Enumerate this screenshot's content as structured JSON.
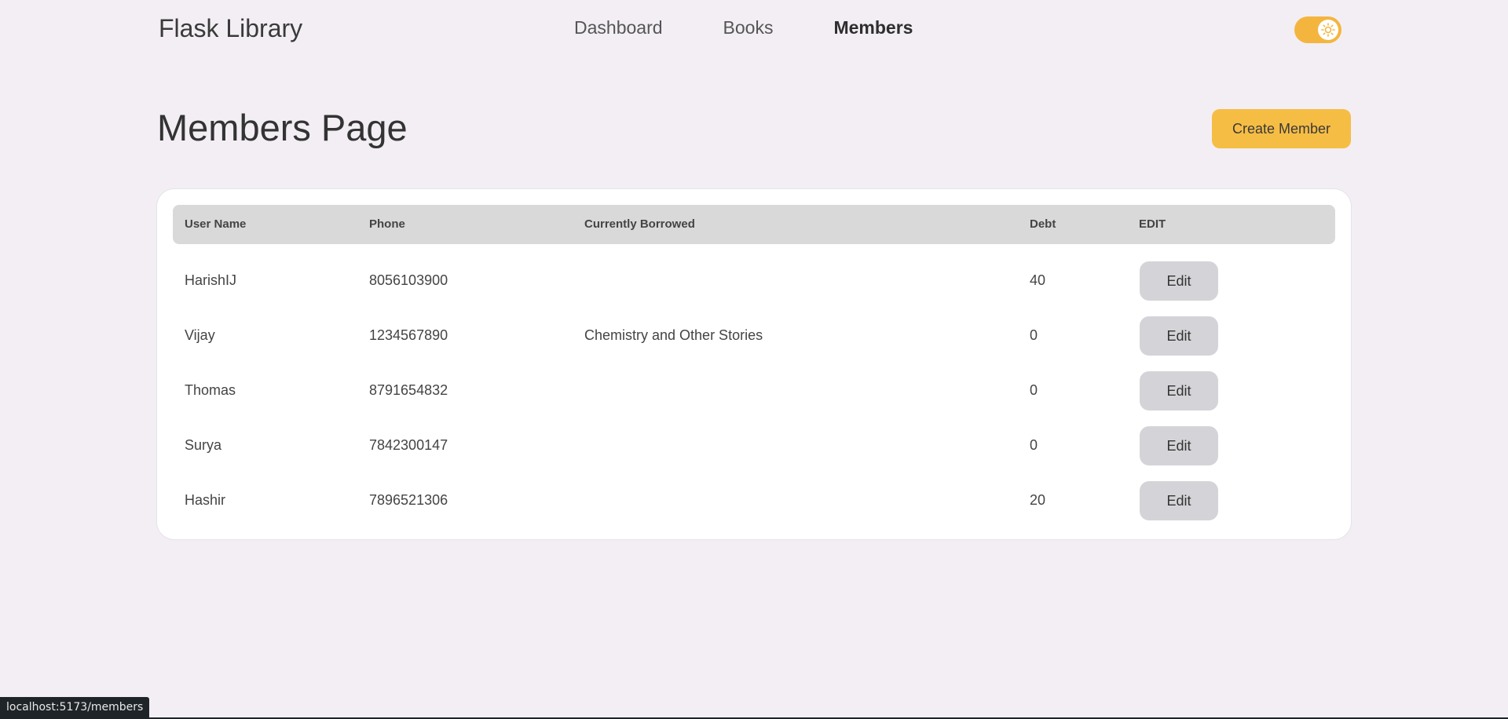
{
  "header": {
    "brand": "Flask Library",
    "nav": [
      "Dashboard",
      "Books",
      "Members"
    ],
    "active_nav": "Members",
    "toggle_icon": "sun-icon",
    "accent_color": "#f4b53f"
  },
  "main": {
    "title": "Members Page",
    "create_label": "Create Member"
  },
  "table": {
    "columns": [
      "User Name",
      "Phone",
      "Currently Borrowed",
      "Debt",
      "EDIT"
    ],
    "rows": [
      {
        "name": "HarishIJ",
        "phone": "8056103900",
        "borrowed": "",
        "debt": "40",
        "edit": "Edit"
      },
      {
        "name": "Vijay",
        "phone": "1234567890",
        "borrowed": "Chemistry and Other Stories",
        "debt": "0",
        "edit": "Edit"
      },
      {
        "name": "Thomas",
        "phone": "8791654832",
        "borrowed": "",
        "debt": "0",
        "edit": "Edit"
      },
      {
        "name": "Surya",
        "phone": "7842300147",
        "borrowed": "",
        "debt": "0",
        "edit": "Edit"
      },
      {
        "name": "Hashir",
        "phone": "7896521306",
        "borrowed": "",
        "debt": "20",
        "edit": "Edit"
      }
    ]
  },
  "status_bar": {
    "url": "localhost:5173/members"
  }
}
